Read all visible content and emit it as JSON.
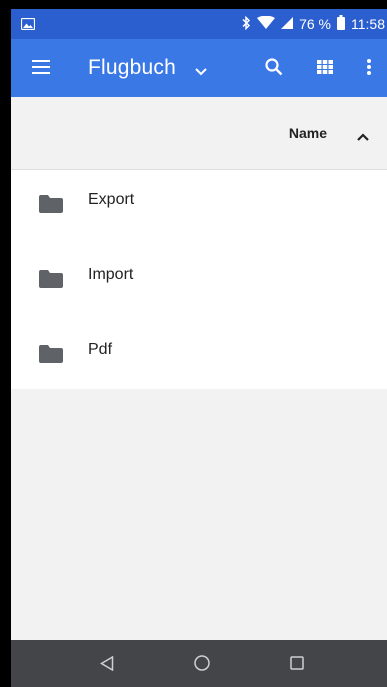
{
  "status_bar": {
    "battery_percent": "76 %",
    "time": "11:58"
  },
  "app_bar": {
    "title": "Flugbuch"
  },
  "sort": {
    "label": "Name",
    "direction": "ascending"
  },
  "files": [
    {
      "name": "Export",
      "icon": "folder-icon"
    },
    {
      "name": "Import",
      "icon": "folder-icon"
    },
    {
      "name": "Pdf",
      "icon": "folder-icon"
    }
  ],
  "colors": {
    "status_bar": "#2b5fcf",
    "app_bar": "#3a78e6",
    "background": "#f2f2f2",
    "nav_bar": "#434548"
  }
}
